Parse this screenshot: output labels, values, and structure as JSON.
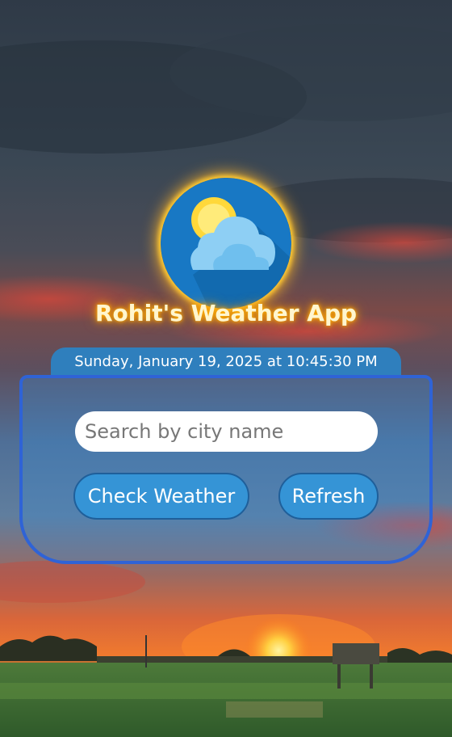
{
  "app": {
    "title": "Rohit's Weather App",
    "datetime": "Sunday, January 19, 2025 at 10:45:30 PM"
  },
  "search": {
    "placeholder": "Search by city name",
    "value": ""
  },
  "buttons": {
    "check_weather": "Check Weather",
    "refresh": "Refresh"
  },
  "logo": {
    "icon": "sun-behind-cloud-icon"
  },
  "colors": {
    "accent_blue": "#2f7fbd",
    "panel_border": "#2f63d6",
    "button_fill": "#3594d6",
    "title_glow": "#ffb300"
  }
}
